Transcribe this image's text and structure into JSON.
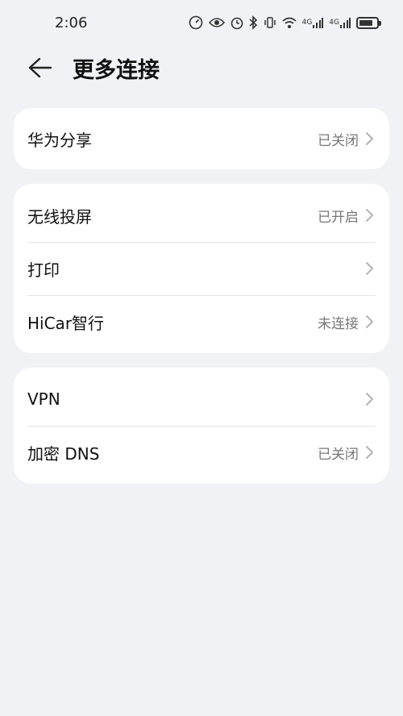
{
  "status_bar": {
    "time": "2:06",
    "sig1": "4G",
    "sig2": "4G"
  },
  "header": {
    "title": "更多连接"
  },
  "groups": [
    {
      "rows": [
        {
          "label": "华为分享",
          "value": "已关闭"
        }
      ]
    },
    {
      "rows": [
        {
          "label": "无线投屏",
          "value": "已开启"
        },
        {
          "label": "打印",
          "value": ""
        },
        {
          "label": "HiCar智行",
          "value": "未连接"
        }
      ]
    },
    {
      "rows": [
        {
          "label": "VPN",
          "value": ""
        },
        {
          "label": "加密 DNS",
          "value": "已关闭"
        }
      ]
    }
  ],
  "colors": {
    "background": "#f1f2f6",
    "card": "#ffffff",
    "secondary_text": "#777777"
  },
  "icons": {
    "back": "arrow-left-icon",
    "chevron": "chevron-right-icon"
  }
}
